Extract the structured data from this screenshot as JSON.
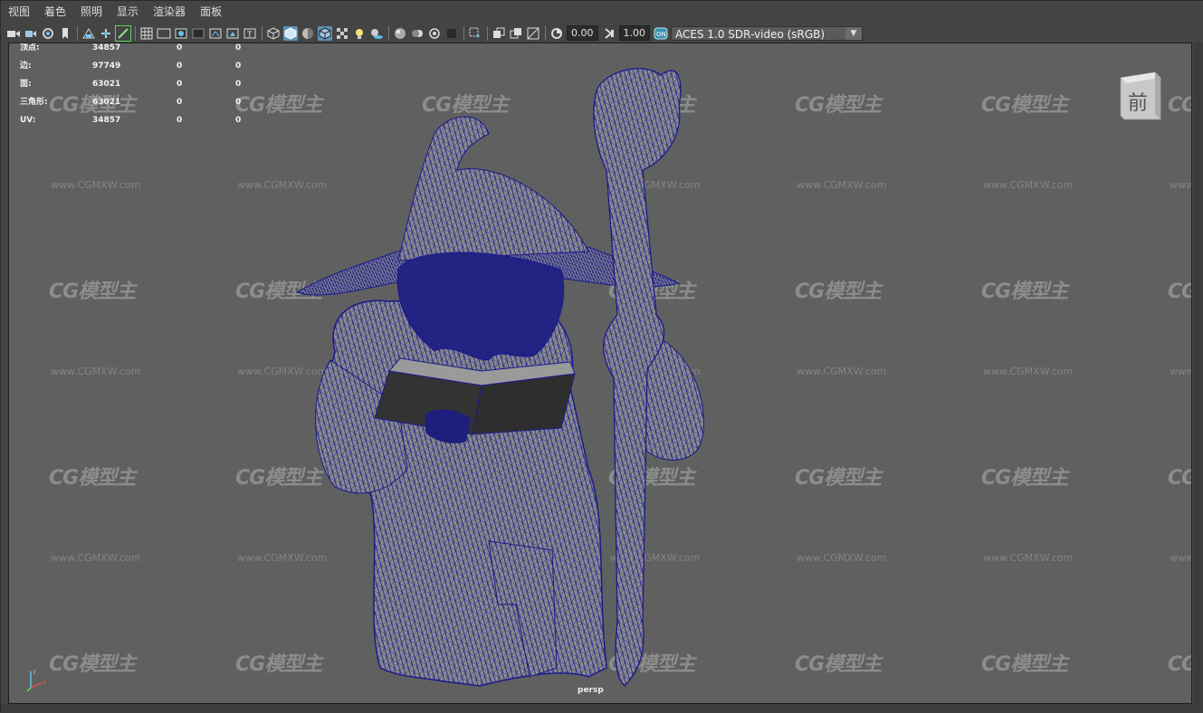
{
  "menu": {
    "items": [
      "视图",
      "着色",
      "照明",
      "显示",
      "渲染器",
      "面板"
    ]
  },
  "toolbar": {
    "exposure_value": "0.00",
    "gamma_value": "1.00",
    "colorspace_select": "ACES 1.0 SDR-video (sRGB)",
    "icons": [
      "camera-icon",
      "camera-attr-icon",
      "bookmark-icon",
      "image-plane-icon",
      "grid-icon",
      "film-gate-icon",
      "resolution-gate-icon",
      "gate-mask-icon",
      "field-chart-icon",
      "safe-action-icon",
      "safe-title-icon",
      "wireframe-icon",
      "smooth-shade-icon",
      "default-material-icon",
      "wireframe-on-shaded-icon",
      "textured-icon",
      "lights-icon",
      "shadows-icon",
      "ssao-icon",
      "motion-blur-icon",
      "anti-alias-icon",
      "depth-of-field-icon",
      "isolate-select-icon",
      "xray-icon",
      "xray-joints-icon",
      "xray-components-icon",
      "exposure-icon",
      "gamma-icon",
      "color-management-icon"
    ]
  },
  "hud": {
    "rows": [
      {
        "label": "顶点:",
        "v1": "34857",
        "v2": "0",
        "v3": "0"
      },
      {
        "label": "边:",
        "v1": "97749",
        "v2": "0",
        "v3": "0"
      },
      {
        "label": "面:",
        "v1": "63021",
        "v2": "0",
        "v3": "0"
      },
      {
        "label": "三角形:",
        "v1": "63021",
        "v2": "0",
        "v3": "0"
      },
      {
        "label": "UV:",
        "v1": "34857",
        "v2": "0",
        "v3": "0"
      }
    ]
  },
  "viewport": {
    "camera_label": "persp",
    "viewcube_label": "前",
    "watermark_logo": "CG模型主",
    "watermark_url": "www.CGMXW.com",
    "background_color": "#606060",
    "wire_color": "#1a1a8c"
  }
}
